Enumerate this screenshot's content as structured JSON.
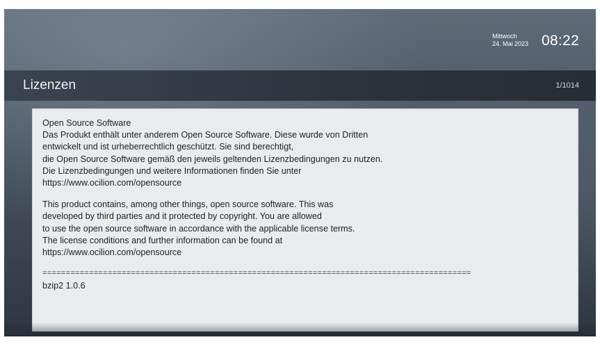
{
  "header": {
    "weekday": "Mittwoch",
    "date": "24. Mai 2023",
    "time": "08:22"
  },
  "page": {
    "title": "Lizenzen",
    "counter": "1/1014"
  },
  "content": {
    "german": [
      "Open Source Software",
      "Das Produkt enthält unter anderem Open Source Software. Diese wurde von Dritten",
      "entwickelt und ist urheberrechtlich geschützt. Sie sind berechtigt,",
      "die Open Source Software gemäß den jeweils geltenden Lizenzbedingungen zu nutzen.",
      "Die Lizenzbedingungen und weitere Informationen finden Sie unter",
      "https://www.ocilion.com/opensource"
    ],
    "english": [
      "This product contains, among other things, open source software. This was",
      "developed by third parties and it protected by copyright. You are allowed",
      "to use the open source software in accordance with the applicable license terms.",
      "The license conditions and further information can be found at",
      "https://www.ocilion.com/opensource"
    ],
    "separator": "============================================================================================",
    "package": "bzip2 1.0.6"
  }
}
